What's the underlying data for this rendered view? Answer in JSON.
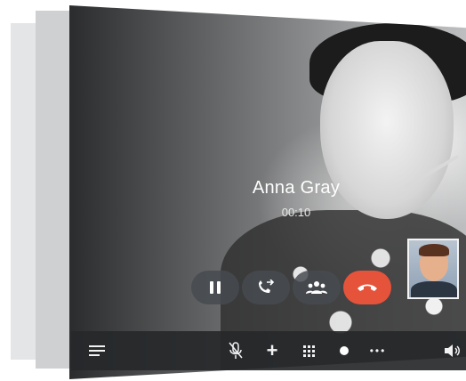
{
  "call": {
    "caller_name": "Anna Gray",
    "duration": "00:10"
  },
  "controls": [
    {
      "name": "hold",
      "icon": "pause-icon"
    },
    {
      "name": "transfer",
      "icon": "transfer-call-icon"
    },
    {
      "name": "conference",
      "icon": "conference-icon"
    },
    {
      "name": "end-call",
      "icon": "hang-up-icon",
      "color": "#e5533b"
    }
  ],
  "toolbar": {
    "items": [
      {
        "name": "menu",
        "icon": "menu-icon"
      },
      {
        "name": "mute",
        "icon": "microphone-muted-icon"
      },
      {
        "name": "add-call",
        "icon": "plus-icon",
        "glyph": "+"
      },
      {
        "name": "keypad",
        "icon": "keypad-icon"
      },
      {
        "name": "record",
        "icon": "record-icon"
      },
      {
        "name": "more",
        "icon": "more-dots-icon",
        "glyph": "•••"
      },
      {
        "name": "volume",
        "icon": "speaker-icon"
      }
    ]
  },
  "colors": {
    "end_call": "#e5533b",
    "button_bg": "#464b50",
    "toolbar_bg": "#26282a"
  }
}
